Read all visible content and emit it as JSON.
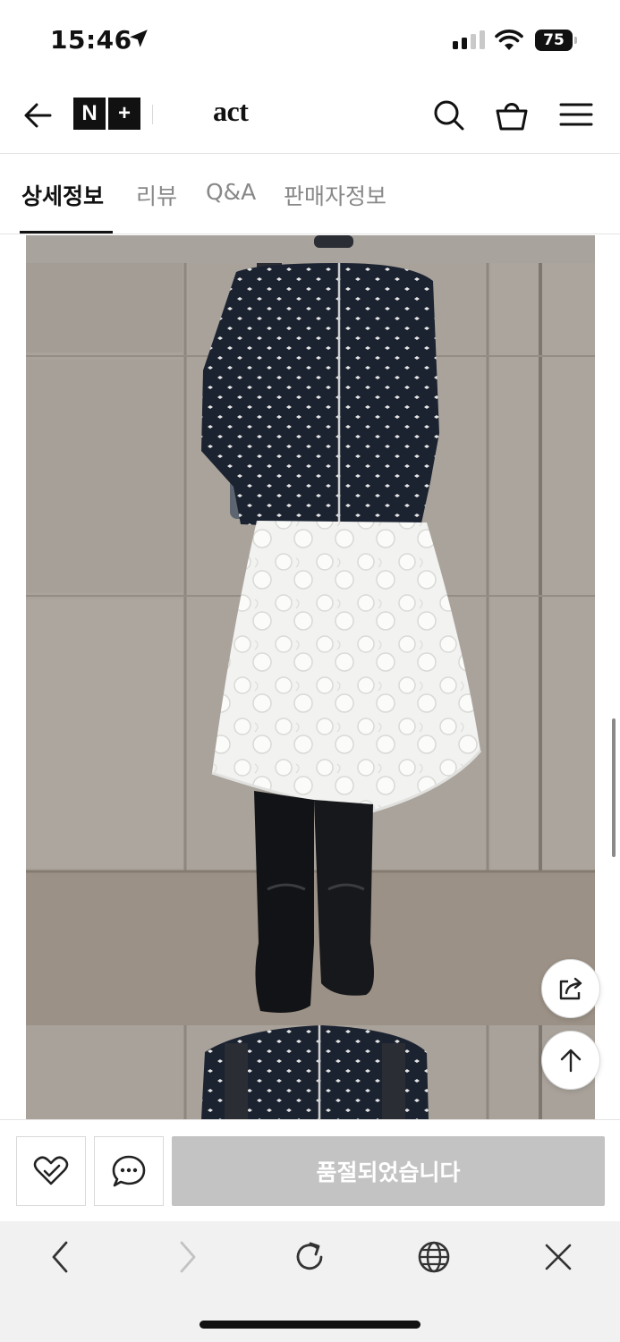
{
  "status_bar": {
    "time": "15:46",
    "battery": "75",
    "icons": [
      "location-arrow-icon",
      "cellular-signal-icon",
      "wifi-icon",
      "battery-icon"
    ]
  },
  "header": {
    "logo_left": "N",
    "logo_right": "+",
    "brand": "act",
    "icons": [
      "back-arrow-icon",
      "search-icon",
      "shopping-bag-icon",
      "hamburger-menu-icon"
    ]
  },
  "tabs": [
    {
      "label": "상세정보",
      "active": true
    },
    {
      "label": "리뷰",
      "active": false
    },
    {
      "label": "Q&A",
      "active": false
    },
    {
      "label": "판매자정보",
      "active": false
    }
  ],
  "floating": {
    "icons": [
      "share-icon",
      "scroll-top-icon"
    ]
  },
  "action_bar": {
    "soldout_label": "품절되었습니다",
    "icons": [
      "wishlist-heart-icon",
      "chat-bubble-icon"
    ]
  },
  "browser_bar": {
    "icons": [
      "browser-back-icon",
      "browser-forward-icon",
      "reload-icon",
      "globe-icon",
      "close-icon"
    ]
  },
  "colors": {
    "soldout_bg": "#c3c3c3",
    "text_primary": "#111111",
    "text_muted": "#888888",
    "browser_bg": "#f1f1f1"
  }
}
